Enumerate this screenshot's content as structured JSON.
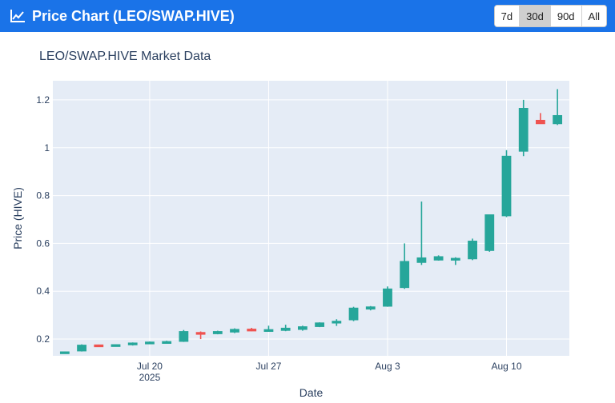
{
  "header": {
    "title": "Price Chart (LEO/SWAP.HIVE)",
    "icon": "line-chart-icon",
    "ranges": [
      "7d",
      "30d",
      "90d",
      "All"
    ],
    "active_range": "30d"
  },
  "colors": {
    "header_bg": "#1a73e8",
    "up": "#26a69a",
    "down": "#ef5350",
    "plot_bg": "#e5ecf6"
  },
  "chart_data": {
    "type": "candlestick",
    "title": "LEO/SWAP.HIVE Market Data",
    "xlabel": "Date",
    "ylabel": "Price (HIVE)",
    "ylim": [
      0.13,
      1.28
    ],
    "yticks": [
      {
        "v": 0.2,
        "label": "0.2"
      },
      {
        "v": 0.4,
        "label": "0.4"
      },
      {
        "v": 0.6,
        "label": "0.6"
      },
      {
        "v": 0.8,
        "label": "0.8"
      },
      {
        "v": 1.0,
        "label": "1"
      },
      {
        "v": 1.2,
        "label": "1.2"
      }
    ],
    "xticks": [
      {
        "date": "2025-07-20",
        "label": "Jul 20",
        "sub": "2025"
      },
      {
        "date": "2025-07-27",
        "label": "Jul 27"
      },
      {
        "date": "2025-08-03",
        "label": "Aug 3"
      },
      {
        "date": "2025-08-10",
        "label": "Aug 10"
      }
    ],
    "candles": [
      {
        "date": "2025-07-15",
        "open": 0.145,
        "high": 0.148,
        "low": 0.142,
        "close": 0.147
      },
      {
        "date": "2025-07-16",
        "open": 0.15,
        "high": 0.178,
        "low": 0.148,
        "close": 0.175
      },
      {
        "date": "2025-07-17",
        "open": 0.176,
        "high": 0.177,
        "low": 0.173,
        "close": 0.174
      },
      {
        "date": "2025-07-18",
        "open": 0.174,
        "high": 0.178,
        "low": 0.172,
        "close": 0.177
      },
      {
        "date": "2025-07-19",
        "open": 0.176,
        "high": 0.186,
        "low": 0.173,
        "close": 0.184
      },
      {
        "date": "2025-07-20",
        "open": 0.183,
        "high": 0.19,
        "low": 0.181,
        "close": 0.188
      },
      {
        "date": "2025-07-21",
        "open": 0.188,
        "high": 0.193,
        "low": 0.186,
        "close": 0.19
      },
      {
        "date": "2025-07-22",
        "open": 0.19,
        "high": 0.238,
        "low": 0.188,
        "close": 0.232
      },
      {
        "date": "2025-07-23",
        "open": 0.228,
        "high": 0.232,
        "low": 0.2,
        "close": 0.222
      },
      {
        "date": "2025-07-24",
        "open": 0.222,
        "high": 0.235,
        "low": 0.22,
        "close": 0.232
      },
      {
        "date": "2025-07-25",
        "open": 0.229,
        "high": 0.245,
        "low": 0.225,
        "close": 0.241
      },
      {
        "date": "2025-07-26",
        "open": 0.242,
        "high": 0.247,
        "low": 0.233,
        "close": 0.236
      },
      {
        "date": "2025-07-27",
        "open": 0.236,
        "high": 0.256,
        "low": 0.232,
        "close": 0.24
      },
      {
        "date": "2025-07-28",
        "open": 0.236,
        "high": 0.26,
        "low": 0.233,
        "close": 0.246
      },
      {
        "date": "2025-07-29",
        "open": 0.24,
        "high": 0.256,
        "low": 0.235,
        "close": 0.252
      },
      {
        "date": "2025-07-30",
        "open": 0.252,
        "high": 0.27,
        "low": 0.25,
        "close": 0.268
      },
      {
        "date": "2025-07-31",
        "open": 0.268,
        "high": 0.283,
        "low": 0.255,
        "close": 0.275
      },
      {
        "date": "2025-08-01",
        "open": 0.28,
        "high": 0.335,
        "low": 0.275,
        "close": 0.33
      },
      {
        "date": "2025-08-02",
        "open": 0.325,
        "high": 0.338,
        "low": 0.32,
        "close": 0.335
      },
      {
        "date": "2025-08-03",
        "open": 0.337,
        "high": 0.42,
        "low": 0.335,
        "close": 0.41
      },
      {
        "date": "2025-08-04",
        "open": 0.415,
        "high": 0.6,
        "low": 0.41,
        "close": 0.525
      },
      {
        "date": "2025-08-05",
        "open": 0.52,
        "high": 0.775,
        "low": 0.51,
        "close": 0.54
      },
      {
        "date": "2025-08-06",
        "open": 0.53,
        "high": 0.55,
        "low": 0.528,
        "close": 0.545
      },
      {
        "date": "2025-08-07",
        "open": 0.535,
        "high": 0.542,
        "low": 0.51,
        "close": 0.538
      },
      {
        "date": "2025-08-08",
        "open": 0.535,
        "high": 0.62,
        "low": 0.53,
        "close": 0.61
      },
      {
        "date": "2025-08-09",
        "open": 0.57,
        "high": 0.72,
        "low": 0.565,
        "close": 0.72
      },
      {
        "date": "2025-08-10",
        "open": 0.715,
        "high": 0.99,
        "low": 0.71,
        "close": 0.965
      },
      {
        "date": "2025-08-11",
        "open": 0.985,
        "high": 1.2,
        "low": 0.965,
        "close": 1.165
      },
      {
        "date": "2025-08-12",
        "open": 1.115,
        "high": 1.145,
        "low": 1.1,
        "close": 1.1
      },
      {
        "date": "2025-08-13",
        "open": 1.1,
        "high": 1.245,
        "low": 1.095,
        "close": 1.135
      }
    ]
  }
}
